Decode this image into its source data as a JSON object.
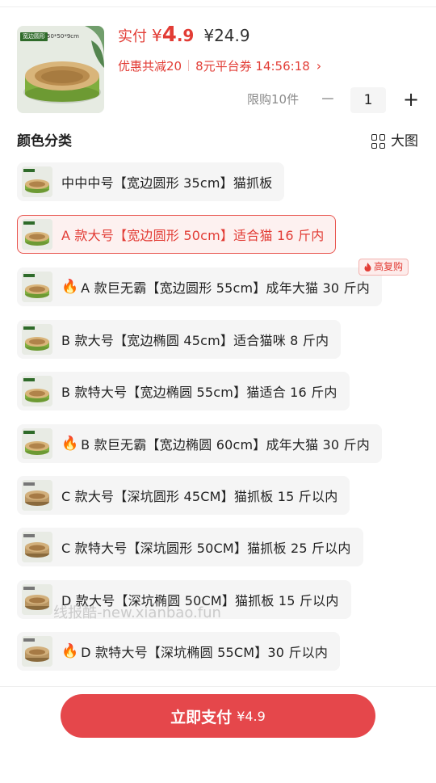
{
  "product": {
    "thumb_tag": "宽边圆形",
    "thumb_size": "50*50*9cm",
    "pay_label": "实付",
    "pay_currency": "¥",
    "pay_amount": "4",
    "pay_decimal": ".9",
    "original_price": "¥24.9",
    "discount_total": "优惠共减20",
    "coupon_text": "8元平台券 14:56:18",
    "chevron": "›",
    "limit_text": "限购10件",
    "quantity": "1",
    "minus": "−",
    "plus": "+"
  },
  "section": {
    "title": "颜色分类",
    "big_picture_label": "大图"
  },
  "hot_badge": "高复购",
  "fire_icon": "🔥",
  "options": [
    {
      "label": "中中中号【宽边圆形 35cm】猫抓板",
      "selected": false,
      "fire": false
    },
    {
      "label": "A 款大号【宽边圆形 50cm】适合猫 16 斤内",
      "selected": true,
      "fire": false
    },
    {
      "label": "A 款巨无霸【宽边圆形 55cm】成年大猫 30 斤内",
      "selected": false,
      "fire": true
    },
    {
      "label": "B 款大号【宽边椭圆 45cm】适合猫咪 8 斤内",
      "selected": false,
      "fire": false
    },
    {
      "label": "B 款特大号【宽边椭圆 55cm】猫适合 16 斤内",
      "selected": false,
      "fire": false
    },
    {
      "label": "B 款巨无霸【宽边椭圆 60cm】成年大猫 30 斤内",
      "selected": false,
      "fire": true
    },
    {
      "label": "C 款大号【深坑圆形 45CM】猫抓板 15 斤以内",
      "selected": false,
      "fire": false
    },
    {
      "label": "C 款特大号【深坑圆形 50CM】猫抓板 25 斤以内",
      "selected": false,
      "fire": false
    },
    {
      "label": "D 款大号【深坑椭圆 50CM】猫抓板 15 斤以内",
      "selected": false,
      "fire": false
    },
    {
      "label": "D 款特大号【深坑椭圆 55CM】30 斤以内",
      "selected": false,
      "fire": true
    }
  ],
  "watermark": "线报酷-new.xianbao.fun",
  "pay_button": {
    "label": "立即支付",
    "price": "¥4.9"
  },
  "colors": {
    "accent": "#e23c35",
    "button": "#e5474b",
    "chip_bg": "#f5f5f5"
  }
}
